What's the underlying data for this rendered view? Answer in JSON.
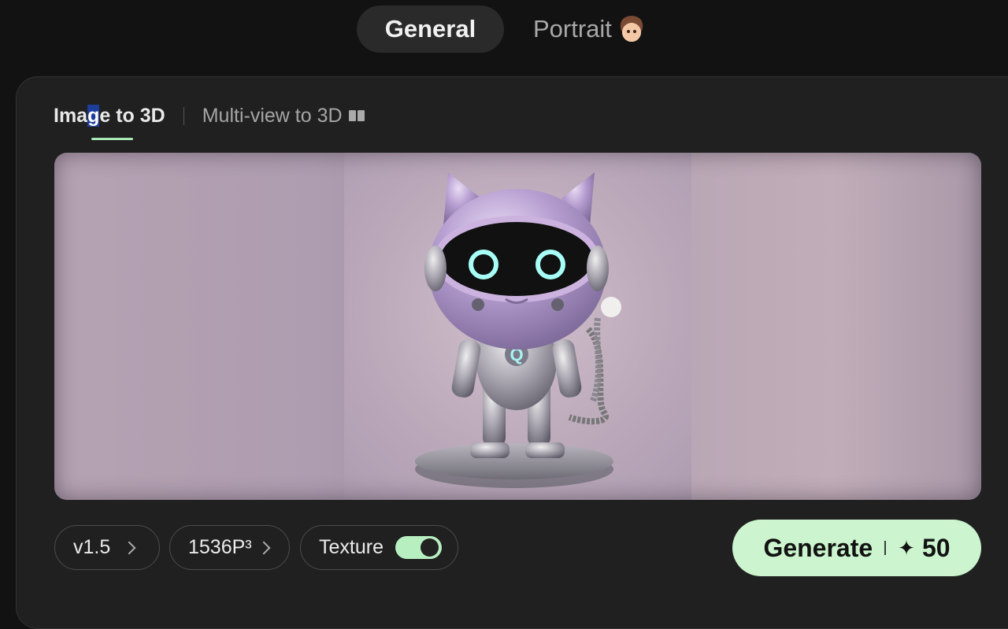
{
  "top_tabs": {
    "general": "General",
    "portrait": "Portrait"
  },
  "mode_tabs": {
    "image_to_3d_part1": "Ima",
    "image_to_3d_highlight": "g",
    "image_to_3d_part2": "e to 3D",
    "multi_view_to_3d": "Multi-view to 3D"
  },
  "image": {
    "badge_letter": "Q"
  },
  "controls": {
    "version": "v1.5",
    "resolution": "1536P³",
    "texture_label": "Texture",
    "texture_enabled": true
  },
  "generate": {
    "label": "Generate",
    "credits": "50"
  },
  "colors": {
    "accent": "#ccf5cf",
    "toggle": "#b8efc1",
    "background": "#121212",
    "panel": "#202020"
  }
}
